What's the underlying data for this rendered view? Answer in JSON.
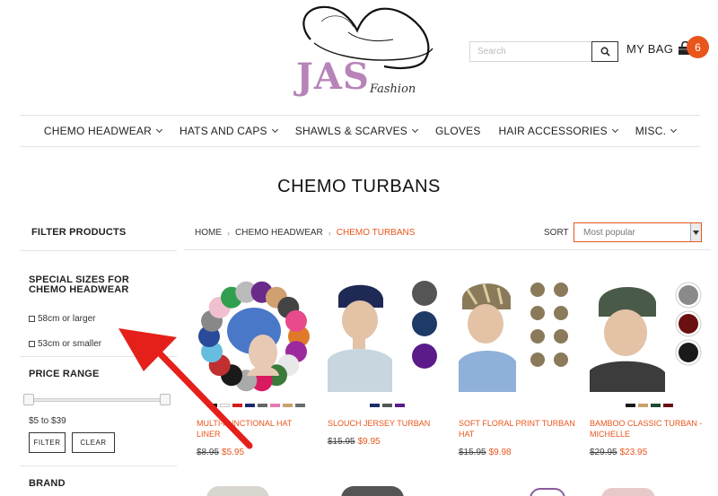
{
  "header": {
    "logo_text": "JAS",
    "logo_sub": "Fashion",
    "search_placeholder": "Search",
    "bag_label": "MY BAG",
    "bag_count": "6"
  },
  "nav": {
    "items": [
      {
        "label": "CHEMO HEADWEAR",
        "dropdown": true
      },
      {
        "label": "HATS AND CAPS",
        "dropdown": true
      },
      {
        "label": "SHAWLS & SCARVES",
        "dropdown": true
      },
      {
        "label": "GLOVES",
        "dropdown": false
      },
      {
        "label": "HAIR ACCESSORIES",
        "dropdown": true
      },
      {
        "label": "MISC.",
        "dropdown": true
      }
    ]
  },
  "page": {
    "title": "CHEMO TURBANS"
  },
  "sidebar": {
    "title": "FILTER PRODUCTS",
    "special_sizes": {
      "heading": "SPECIAL SIZES FOR CHEMO HEADWEAR",
      "options": [
        "58cm or larger",
        "53cm or smaller"
      ]
    },
    "price_range": {
      "heading": "PRICE RANGE",
      "range_text": "$5 to $39",
      "filter_label": "FILTER",
      "clear_label": "CLEAR"
    },
    "brand": {
      "heading": "BRAND"
    }
  },
  "breadcrumb": {
    "items": [
      "HOME",
      "CHEMO HEADWEAR",
      "CHEMO TURBANS"
    ]
  },
  "sort": {
    "label": "SORT",
    "selected": "Most popular"
  },
  "products": [
    {
      "name": "MULTI-FUNCTIONAL HAT LINER",
      "old_price": "$8.95",
      "new_price": "$5.95",
      "swatches": [
        "#1a1a1a",
        "#ffffff",
        "#d01c1c",
        "#1b2a6b",
        "#666666",
        "#e87ab0",
        "#c9a36b",
        "#6b6b6b"
      ]
    },
    {
      "name": "SLOUCH JERSEY TURBAN",
      "old_price": "$15.95",
      "new_price": "$9.95",
      "swatches": [
        "#1b2a6b",
        "#555555",
        "#5b1c8a"
      ]
    },
    {
      "name": "SOFT FLORAL PRINT TURBAN HAT",
      "old_price": "$15.95",
      "new_price": "$9.98",
      "swatches": []
    },
    {
      "name": "BAMBOO CLASSIC TURBAN - MICHELLE",
      "old_price": "$29.95",
      "new_price": "$23.95",
      "swatches": [
        "#1a1a1a",
        "#c9a36b",
        "#1f4a30",
        "#6b1010"
      ]
    }
  ]
}
